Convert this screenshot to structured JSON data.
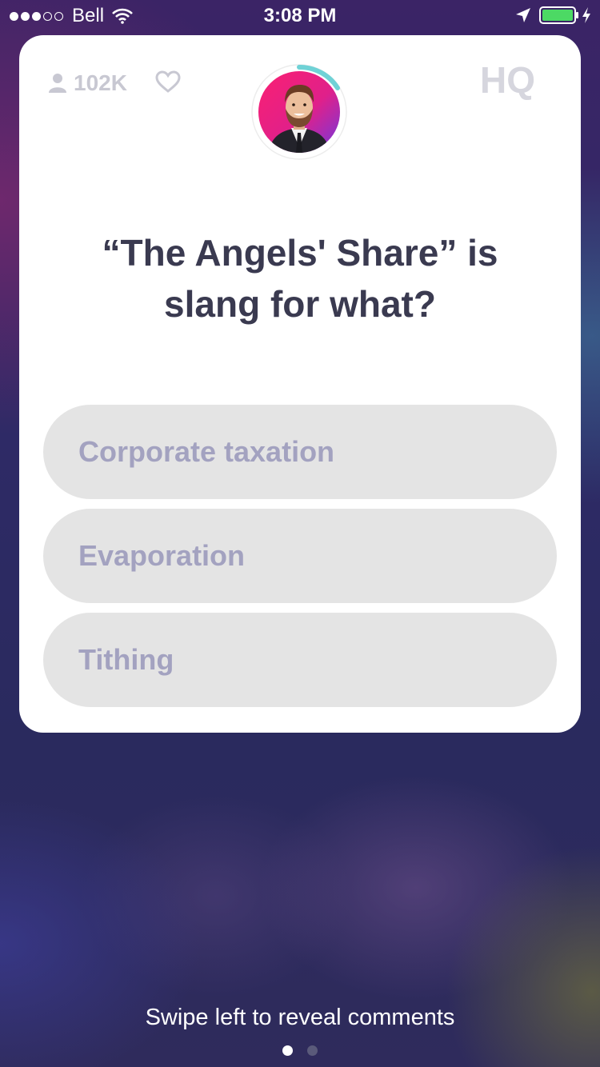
{
  "status_bar": {
    "carrier": "Bell",
    "time": "3:08 PM",
    "signal_bars_filled": 3,
    "signal_bars_total": 5,
    "battery_color": "#4cd964"
  },
  "card": {
    "viewer_count": "102K",
    "logo_text": "HQ",
    "question": "“The Angels' Share” is slang for what?",
    "answers": [
      {
        "label": "Corporate taxation"
      },
      {
        "label": "Evaporation"
      },
      {
        "label": "Tithing"
      }
    ],
    "timer_color": "#6fd2d6"
  },
  "footer": {
    "swipe_hint": "Swipe left to reveal comments",
    "page_count": 2,
    "current_page": 1
  },
  "icons": {
    "viewers": "person-icon",
    "like": "heart-icon",
    "location": "location-arrow-icon",
    "wifi": "wifi-icon",
    "battery": "battery-icon",
    "charging": "bolt-icon"
  }
}
